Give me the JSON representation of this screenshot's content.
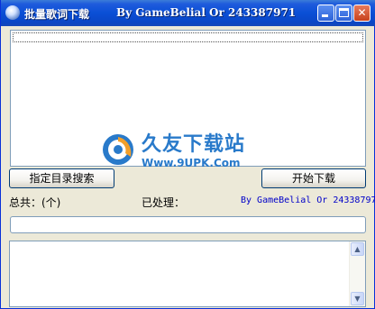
{
  "window": {
    "title": "批量歌词下载",
    "title_credit": "By GameBelial Or 243387971",
    "controls": {
      "minimize": "minimize-icon",
      "maximize": "maximize-icon",
      "close": "close-icon"
    }
  },
  "buttons": {
    "search_label": "指定目录搜索",
    "start_label": "开始下载"
  },
  "status": {
    "total_label": "总共：(个)",
    "processed_label": "已处理：",
    "credit": "By GameBelial Or 243387971"
  },
  "progress": {
    "value_percent": 0
  },
  "watermark": {
    "title": "久友下载站",
    "url": "Www.9UPK.Com"
  },
  "colors": {
    "titlebar": "#0a4fd6",
    "face": "#ece9d8",
    "credit_text": "#0000c8",
    "progress_fill": "#2fbb3c",
    "watermark": "#1e73c8"
  }
}
